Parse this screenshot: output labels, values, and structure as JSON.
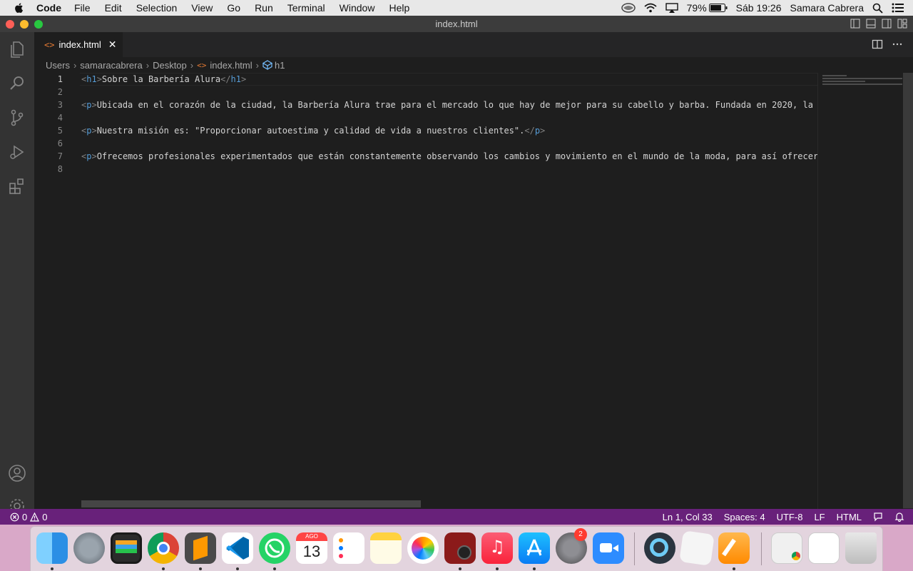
{
  "menubar": {
    "items": [
      "Code",
      "File",
      "Edit",
      "Selection",
      "View",
      "Go",
      "Run",
      "Terminal",
      "Window",
      "Help"
    ],
    "battery": "79%",
    "clock": "Sáb 19:26",
    "user": "Samara Cabrera"
  },
  "window": {
    "title": "index.html",
    "tab": {
      "label": "index.html"
    },
    "breadcrumb": [
      "Users",
      "samaracabrera",
      "Desktop",
      "index.html",
      "h1"
    ]
  },
  "editor": {
    "lines": [
      {
        "num": "1",
        "open": "h1",
        "text": "Sobre la Barbería Alura",
        "close": "h1"
      },
      {
        "num": "2",
        "open": "",
        "text": "",
        "close": ""
      },
      {
        "num": "3",
        "open": "p",
        "text": "Ubicada en el corazón de la ciudad, la Barbería Alura trae para el mercado lo que hay de mejor para su cabello y barba. Fundada en 2020, la",
        "close": ""
      },
      {
        "num": "4",
        "open": "",
        "text": "",
        "close": ""
      },
      {
        "num": "5",
        "open": "p",
        "text": "Nuestra misión es: \"Proporcionar autoestima y calidad de vida a nuestros clientes\".",
        "close": "p"
      },
      {
        "num": "6",
        "open": "",
        "text": "",
        "close": ""
      },
      {
        "num": "7",
        "open": "p",
        "text": "Ofrecemos profesionales experimentados que están constantemente observando los cambios y movimiento en el mundo de la moda, para así ofrecer",
        "close": ""
      },
      {
        "num": "8",
        "open": "",
        "text": "",
        "close": ""
      }
    ]
  },
  "statusbar": {
    "errors": "0",
    "warnings": "0",
    "cursor": "Ln 1, Col 33",
    "spaces": "Spaces: 4",
    "encoding": "UTF-8",
    "eol": "LF",
    "language": "HTML"
  },
  "dock": {
    "calendar_month": "AGO",
    "calendar_day": "13",
    "settings_badge": "2"
  },
  "colors": {
    "statusbar": "#68217a",
    "editor_bg": "#1e1e1e",
    "tag": "#569cd6",
    "text": "#d4d4d4"
  }
}
